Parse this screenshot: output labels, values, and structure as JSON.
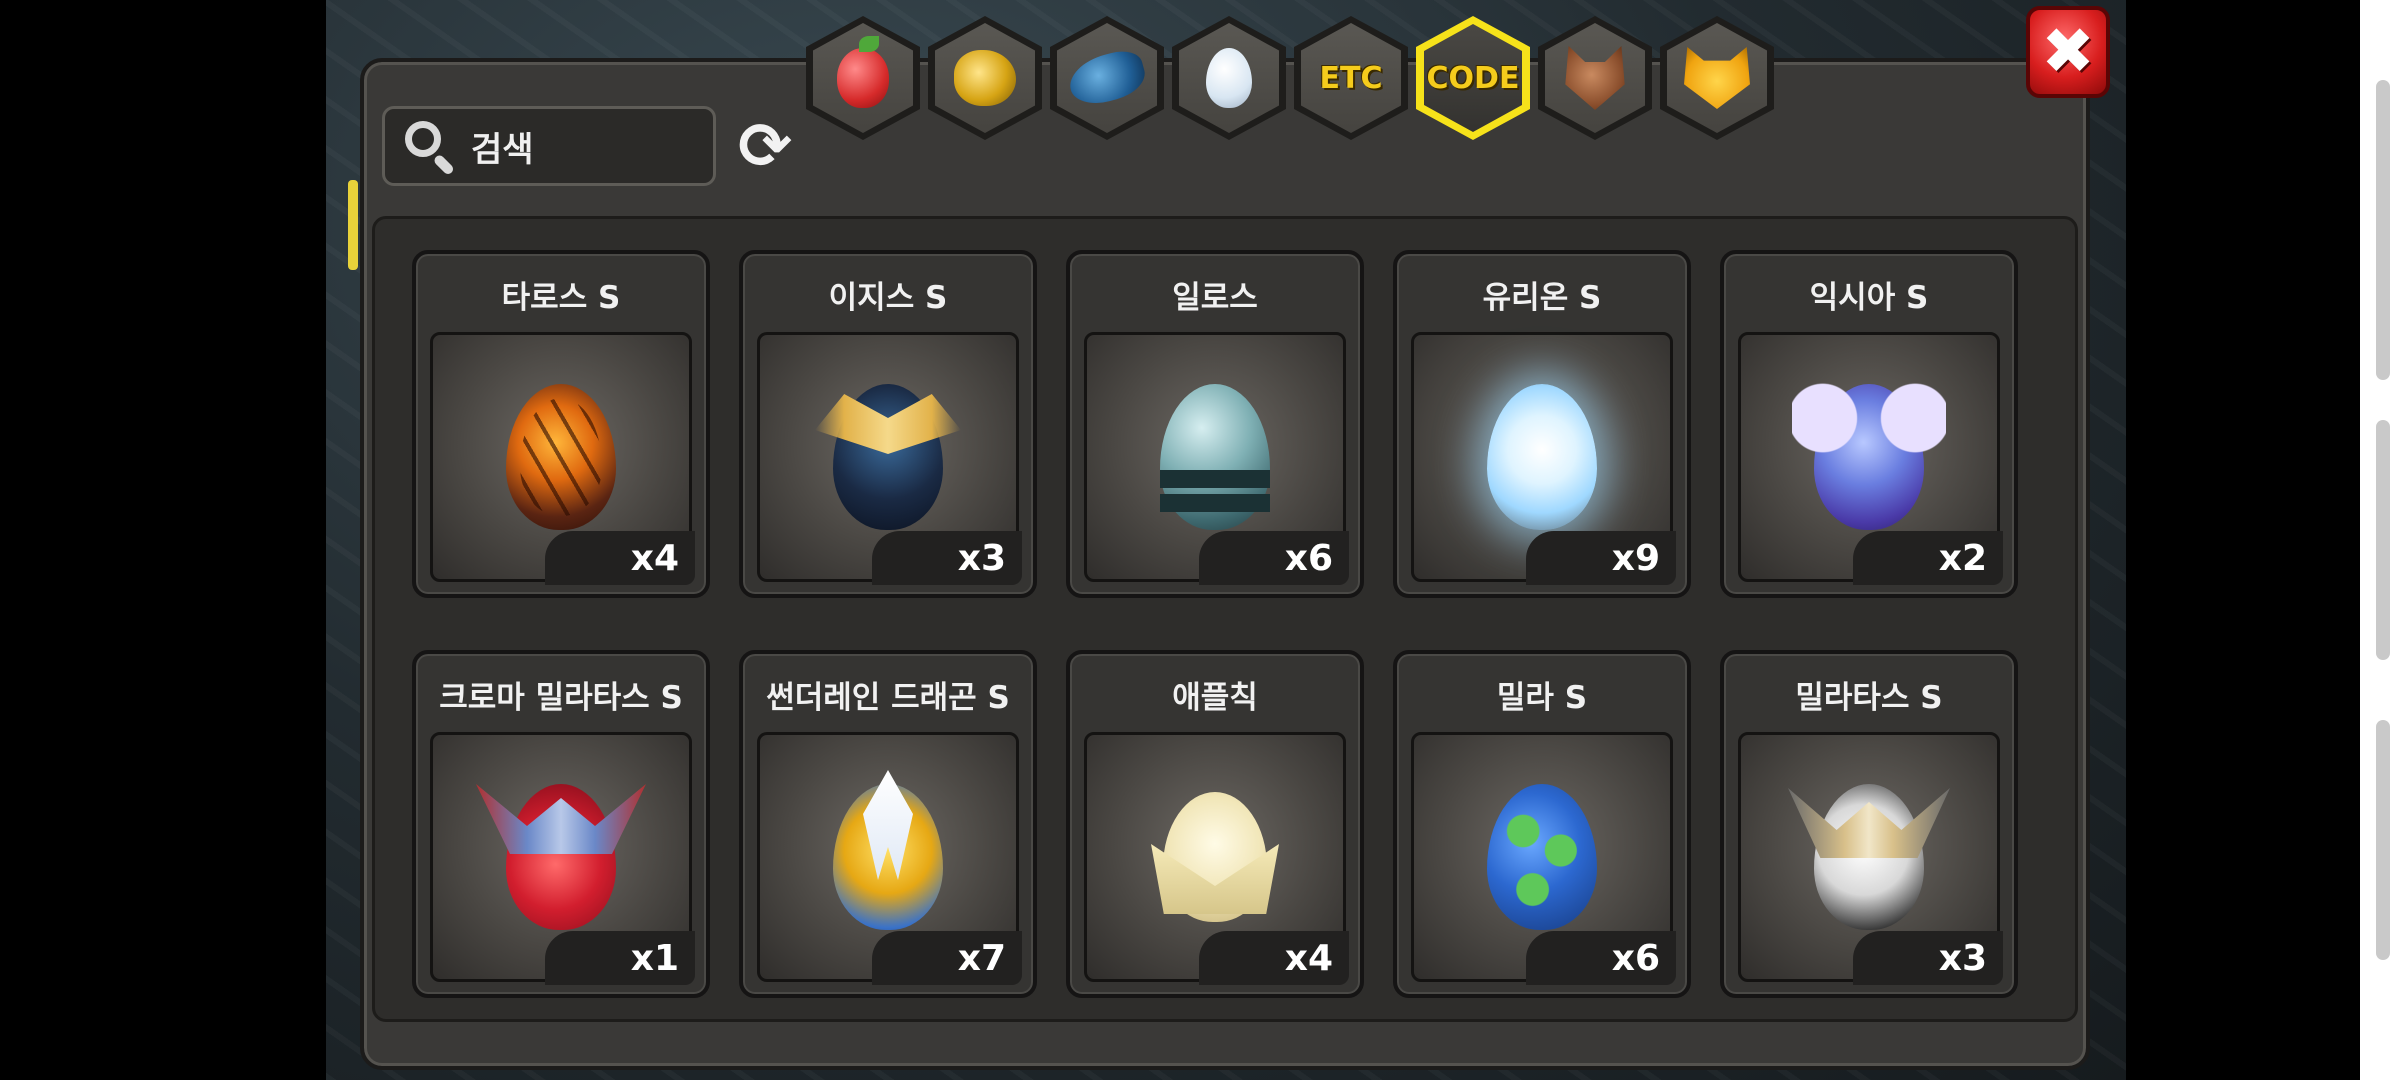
{
  "search": {
    "placeholder": "검색"
  },
  "tabs": [
    {
      "icon": "fruit-icon",
      "label": ""
    },
    {
      "icon": "gold-nugget-icon",
      "label": ""
    },
    {
      "icon": "dragon-claw-icon",
      "label": ""
    },
    {
      "icon": "egg-icon",
      "label": ""
    },
    {
      "icon": "etc-icon",
      "label": "ETC"
    },
    {
      "icon": "code-icon",
      "label": "CODE",
      "active": true
    },
    {
      "icon": "wolf-head-icon",
      "label": ""
    },
    {
      "icon": "cat-face-icon",
      "label": ""
    }
  ],
  "items": [
    {
      "name": "타로스 S",
      "qty": "x4",
      "icon": "taros-egg"
    },
    {
      "name": "이지스 S",
      "qty": "x3",
      "icon": "isis-egg"
    },
    {
      "name": "일로스",
      "qty": "x6",
      "icon": "ilos-egg"
    },
    {
      "name": "유리온 S",
      "qty": "x9",
      "icon": "urion-egg"
    },
    {
      "name": "익시아 S",
      "qty": "x2",
      "icon": "ixia-egg"
    },
    {
      "name": "크로마 밀라타스 S",
      "qty": "x1",
      "icon": "chroma-milatas-egg"
    },
    {
      "name": "썬더레인 드래곤 S",
      "qty": "x7",
      "icon": "thunderain-dragon-egg"
    },
    {
      "name": "애플칙",
      "qty": "x4",
      "icon": "applechick-egg"
    },
    {
      "name": "밀라 S",
      "qty": "x6",
      "icon": "mila-egg"
    },
    {
      "name": "밀라타스 S",
      "qty": "x3",
      "icon": "milatas-egg"
    }
  ],
  "colors": {
    "active_tab_border": "#f6e21a",
    "close_red": "#d81e1e",
    "panel_bg": "#3a3937"
  }
}
